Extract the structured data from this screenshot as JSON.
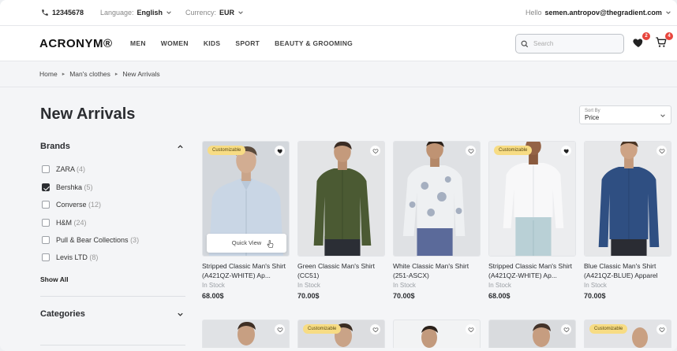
{
  "topbar": {
    "phone": "12345678",
    "language_label": "Language:",
    "language_value": "English",
    "currency_label": "Currency:",
    "currency_value": "EUR",
    "greeting": "Hello",
    "user_email": "semen.antropov@thegradient.com"
  },
  "header": {
    "logo": "ACRONYM®",
    "nav": [
      "MEN",
      "WOMEN",
      "KIDS",
      "SPORT",
      "BEAUTY & GROOMING"
    ],
    "search_placeholder": "Search",
    "wishlist_count": "2",
    "cart_count": "4"
  },
  "breadcrumb": [
    "Home",
    "Man's clothes",
    "New Arrivals"
  ],
  "page": {
    "title": "New Arrivals",
    "sort_label": "Sort By",
    "sort_value": "Price"
  },
  "sidebar": {
    "brands_title": "Brands",
    "brands": [
      {
        "name": "ZARA",
        "count": "(4)",
        "checked": false
      },
      {
        "name": "Bershka",
        "count": "(5)",
        "checked": true
      },
      {
        "name": "Converse",
        "count": "(12)",
        "checked": false
      },
      {
        "name": "H&M",
        "count": "(24)",
        "checked": false
      },
      {
        "name": "Pull & Bear Collections",
        "count": "(3)",
        "checked": false
      },
      {
        "name": "Levis LTD",
        "count": "(8)",
        "checked": false
      }
    ],
    "show_all": "Show All",
    "categories_title": "Categories"
  },
  "products": [
    {
      "name": "Stripped Classic Man's Shirt (A421QZ-WHITE) Ap...",
      "stock": "In Stock",
      "price": "68.00$",
      "tag": "Customizable",
      "quick_view": "Quick View",
      "shirt_color": "#cfdbe8",
      "bg": "#d5d8dd",
      "pants": "#e6e7ea"
    },
    {
      "name": "Green Classic Man's Shirt (CC51)",
      "stock": "In Stock",
      "price": "70.00$",
      "tag": "",
      "shirt_color": "#4b5a33",
      "bg": "#e4e5e7",
      "pants": "#2c2f36"
    },
    {
      "name": "White Classic Man's Shirt (251-ASCX)",
      "stock": "In Stock",
      "price": "70.00$",
      "tag": "",
      "shirt_color": "#eef0f2",
      "bg": "#dfe1e4",
      "pants": "#5b6a9a"
    },
    {
      "name": "Stripped Classic Man's Shirt (A421QZ-WHITE) Ap...",
      "stock": "In Stock",
      "price": "68.00$",
      "tag": "Customizable",
      "shirt_color": "#f7f7f8",
      "bg": "#ecedef",
      "pants": "#b9d0d6"
    },
    {
      "name": "Blue Classic Man's Shirt (A421QZ-BLUE) Apparel",
      "stock": "In Stock",
      "price": "70.00$",
      "tag": "",
      "shirt_color": "#2f4f82",
      "bg": "#e6e7e9",
      "pants": "#2a2c33"
    }
  ],
  "products_row2": [
    {
      "tag": "",
      "bg": "#e0e2e5"
    },
    {
      "tag": "Customizable",
      "bg": "#dcdde0"
    },
    {
      "tag": "",
      "bg": "#f2f3f4"
    },
    {
      "tag": "",
      "bg": "#d9dbde"
    },
    {
      "tag": "Customizable",
      "bg": "#e2e3e6"
    }
  ]
}
